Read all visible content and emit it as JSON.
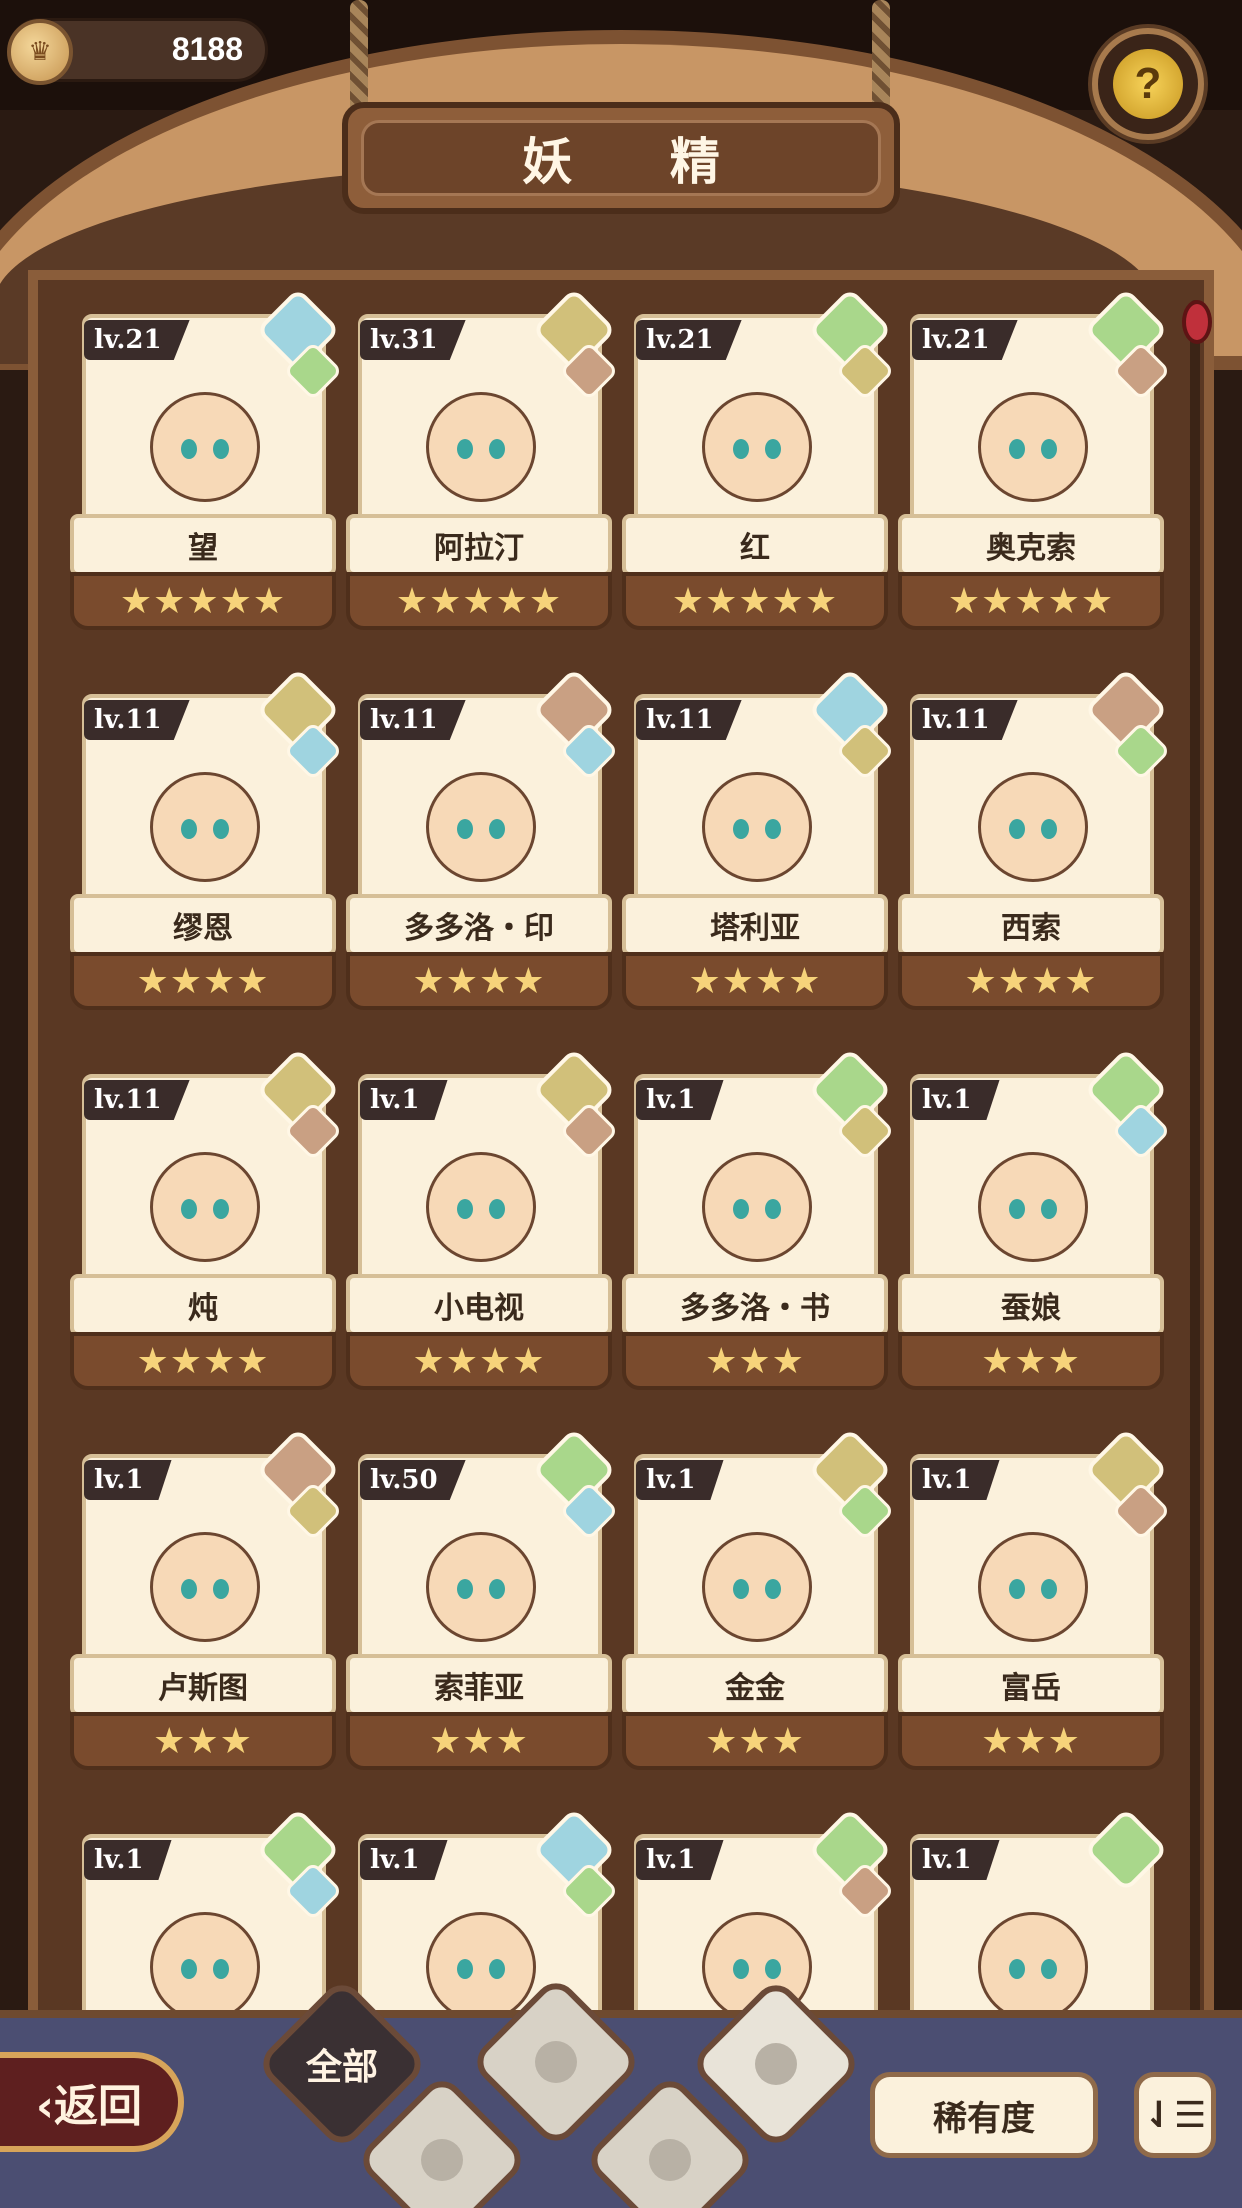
{
  "currency": {
    "value": "8188",
    "icon": "coin-icon"
  },
  "help": {
    "icon": "help-sprout-icon",
    "glyph": "?"
  },
  "title": "妖 精",
  "fairies": [
    {
      "level": "lv.21",
      "name": "望",
      "stars": "★★★★★",
      "elements": [
        "water",
        "plant"
      ]
    },
    {
      "level": "lv.31",
      "name": "阿拉汀",
      "stars": "★★★★★",
      "elements": [
        "earth",
        "mountain"
      ]
    },
    {
      "level": "lv.21",
      "name": "红",
      "stars": "★★★★★",
      "elements": [
        "plant",
        "earth"
      ]
    },
    {
      "level": "lv.21",
      "name": "奥克索",
      "stars": "★★★★★",
      "elements": [
        "plant",
        "mountain"
      ]
    },
    {
      "level": "lv.11",
      "name": "缪恩",
      "stars": "★★★★",
      "elements": [
        "earth",
        "water"
      ]
    },
    {
      "level": "lv.11",
      "name": "多多洛・印",
      "stars": "★★★★",
      "elements": [
        "mountain",
        "water"
      ]
    },
    {
      "level": "lv.11",
      "name": "塔利亚",
      "stars": "★★★★",
      "elements": [
        "water",
        "earth"
      ]
    },
    {
      "level": "lv.11",
      "name": "西索",
      "stars": "★★★★",
      "elements": [
        "mountain",
        "plant"
      ]
    },
    {
      "level": "lv.11",
      "name": "炖",
      "stars": "★★★★",
      "elements": [
        "earth",
        "mountain"
      ]
    },
    {
      "level": "lv.1",
      "name": "小电视",
      "stars": "★★★★",
      "elements": [
        "earth",
        "mountain"
      ]
    },
    {
      "level": "lv.1",
      "name": "多多洛・书",
      "stars": "★★★",
      "elements": [
        "plant",
        "earth"
      ]
    },
    {
      "level": "lv.1",
      "name": "蚕娘",
      "stars": "★★★",
      "elements": [
        "plant",
        "water"
      ]
    },
    {
      "level": "lv.1",
      "name": "卢斯图",
      "stars": "★★★",
      "elements": [
        "mountain",
        "earth"
      ]
    },
    {
      "level": "lv.50",
      "name": "索菲亚",
      "stars": "★★★",
      "elements": [
        "plant",
        "water"
      ]
    },
    {
      "level": "lv.1",
      "name": "金金",
      "stars": "★★★",
      "elements": [
        "earth",
        "plant"
      ]
    },
    {
      "level": "lv.1",
      "name": "富岳",
      "stars": "★★★",
      "elements": [
        "earth",
        "mountain"
      ]
    },
    {
      "level": "lv.1",
      "name": "",
      "stars": "",
      "elements": [
        "plant",
        "water"
      ]
    },
    {
      "level": "lv.1",
      "name": "",
      "stars": "",
      "elements": [
        "water",
        "plant"
      ]
    },
    {
      "level": "lv.1",
      "name": "",
      "stars": "",
      "elements": [
        "plant",
        "mountain"
      ]
    },
    {
      "level": "lv.1",
      "name": "",
      "stars": "",
      "elements": [
        "plant"
      ]
    }
  ],
  "bottom": {
    "back_label": "‹返回",
    "tabs": [
      {
        "id": "all",
        "label": "全部"
      },
      {
        "id": "water",
        "icon": "water-drop-icon"
      },
      {
        "id": "plant",
        "icon": "sprout-icon"
      },
      {
        "id": "earth",
        "icon": "earth-icon"
      },
      {
        "id": "mountain",
        "icon": "mountain-icon"
      }
    ],
    "sort_label": "稀有度",
    "order_glyph": "⇃☰"
  }
}
